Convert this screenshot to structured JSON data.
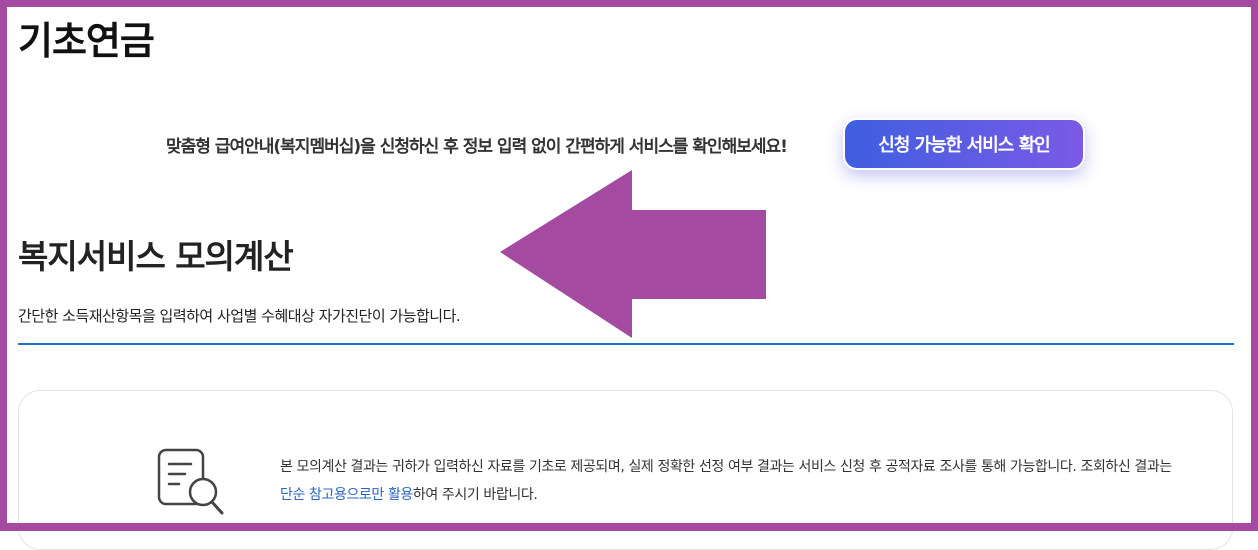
{
  "header": {
    "title": "기초연금"
  },
  "promo": {
    "text": "맞춤형 급여안내(복지멤버십)을 신청하신 후 정보 입력 없이 간편하게 서비스를 확인해보세요!",
    "button_label": "신청 가능한 서비스 확인"
  },
  "simulator": {
    "title": "복지서비스 모의계산",
    "description": "간단한 소득재산항목을 입력하여 사업별 수혜대상 자가진단이 가능합니다."
  },
  "notice": {
    "icon": "document-search-icon",
    "text_before": "본 모의계산 결과는 귀하가 입력하신 자료를 기초로 제공되며, 실제 정확한 선정 여부 결과는 서비스 신청 후 공적자료 조사를 통해 가능합니다. 조회하신 결과는 ",
    "highlight": "단순 참고용으로만 활용",
    "text_after": "하여 주시기 바랍니다."
  },
  "annotation": {
    "arrow_icon": "left-arrow-icon"
  },
  "colors": {
    "frame": "#a54aa1",
    "arrow": "#a54aa1",
    "button_start": "#3f5fe0",
    "button_end": "#7a5ae6",
    "rule": "#1a73c8",
    "highlight": "#2b66c7"
  }
}
